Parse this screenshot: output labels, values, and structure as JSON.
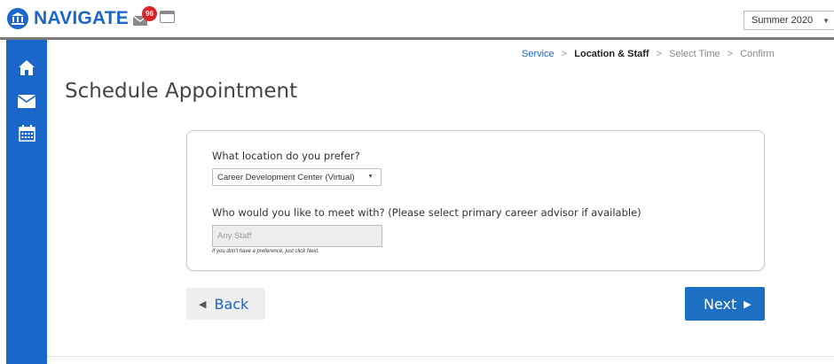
{
  "header": {
    "logo_text": "NAVIGATE",
    "notification_count": "96",
    "term_select": "Summer 2020"
  },
  "sidebar": {
    "items": [
      {
        "icon": "home-icon"
      },
      {
        "icon": "mail-icon"
      },
      {
        "icon": "calendar-icon"
      }
    ]
  },
  "breadcrumb": {
    "steps": [
      "Service",
      "Location & Staff",
      "Select Time",
      "Confirm"
    ],
    "separator": ">"
  },
  "page": {
    "title": "Schedule Appointment"
  },
  "form": {
    "location_question": "What location do you prefer?",
    "location_value": "Career Development Center (Virtual)",
    "staff_question": "Who would you like to meet with? (Please select primary career advisor if available)",
    "staff_placeholder": "Any Staff",
    "staff_hint": "If you don't have a preference, just click Next."
  },
  "actions": {
    "back_label": "Back",
    "next_label": "Next"
  },
  "colors": {
    "brand_blue": "#1b67c9",
    "badge_red": "#d9262b"
  }
}
